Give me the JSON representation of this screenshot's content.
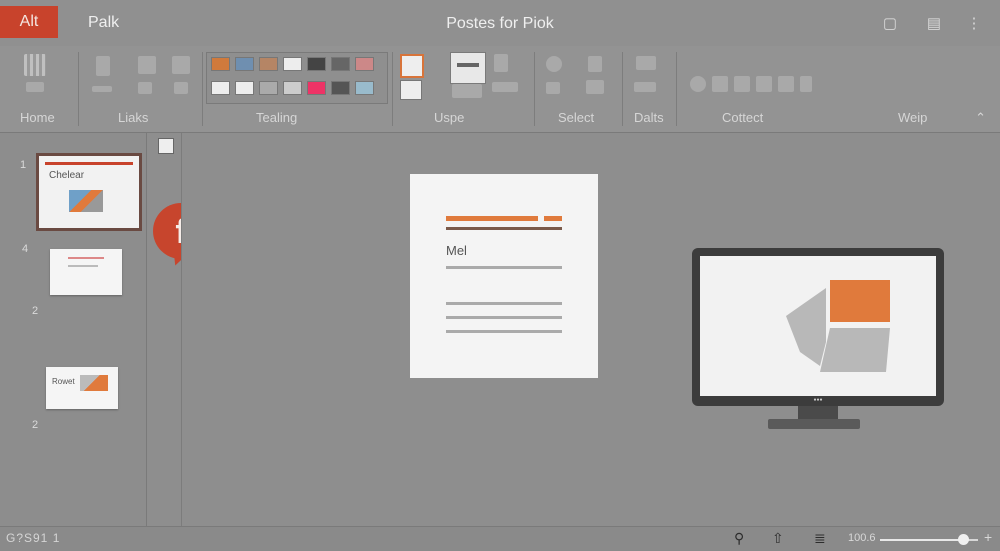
{
  "titlebar": {
    "app_tab": "Alt",
    "file_name": "Palk",
    "title": "Postes for Piok",
    "controls": [
      "minimize-icon",
      "restore-icon",
      "more-icon"
    ]
  },
  "ribbon": {
    "groups": [
      "Home",
      "Liaks",
      "Tealing",
      "Uspe",
      "Select",
      "Dalts",
      "Cottect",
      "Weip"
    ]
  },
  "slides": [
    {
      "number": "1",
      "title": "Chelear"
    },
    {
      "number": "4",
      "title": ""
    },
    {
      "number": "2",
      "title": ""
    },
    {
      "number": "2",
      "title": "Rowet"
    }
  ],
  "canvas": {
    "doc_label": "Mel",
    "badge": "f",
    "monitor_brand": "●●●"
  },
  "status": {
    "text": "G?S91 1",
    "zoom": "100.6",
    "zoom_level": 0.85
  },
  "colors": {
    "accent": "#c8432c",
    "orange": "#e07a3c",
    "background": "#8e8e8e"
  }
}
